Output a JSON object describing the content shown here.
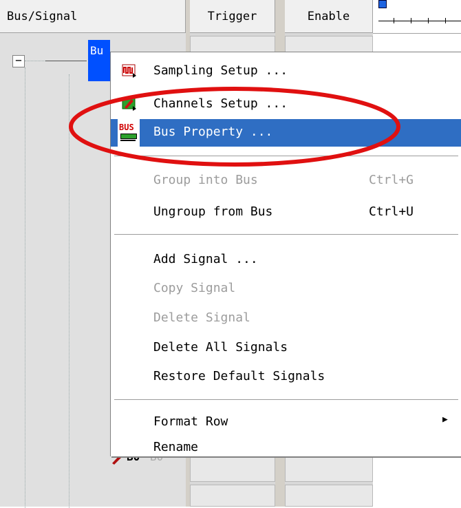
{
  "columns": {
    "bus_signal": "Bus/Signal",
    "trigger": "Trigger",
    "enable": "Enable"
  },
  "tree": {
    "collapse_glyph": "−",
    "bus_node_label": "Bu",
    "signal_label": "B0",
    "signal_label_ghost": "B0"
  },
  "menu": {
    "items": [
      {
        "label": "Sampling Setup ...",
        "icon": "sampling-setup-icon"
      },
      {
        "label": "Channels Setup ...",
        "icon": "channels-setup-icon"
      },
      {
        "label": "Bus Property ...",
        "icon": "bus-property-icon",
        "icon_text": "BUS",
        "highlighted": true
      },
      {
        "label": "Group into Bus",
        "shortcut": "Ctrl+G",
        "disabled": true
      },
      {
        "label": "Ungroup from Bus",
        "shortcut": "Ctrl+U"
      },
      {
        "label": "Add Signal ..."
      },
      {
        "label": "Copy Signal",
        "disabled": true
      },
      {
        "label": "Delete Signal",
        "disabled": true
      },
      {
        "label": "Delete All Signals"
      },
      {
        "label": "Restore Default Signals"
      },
      {
        "label": "Format Row",
        "submenu_arrow": "▶"
      },
      {
        "label": "Rename"
      }
    ]
  },
  "colors": {
    "selection": "#2f6ec3",
    "annotation_ellipse": "#e01010",
    "bus_node_bg": "#0050ff"
  }
}
